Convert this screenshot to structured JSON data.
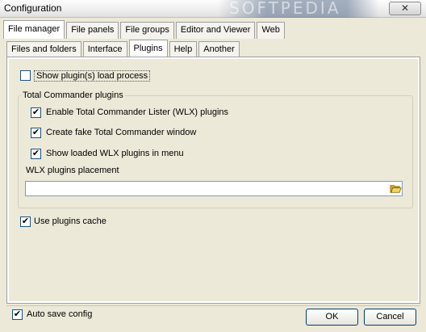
{
  "window": {
    "title": "Configuration",
    "close_label": "✕",
    "watermark": "SOFTPEDIA"
  },
  "tabs_primary": [
    {
      "label": "File manager",
      "active": true
    },
    {
      "label": "File panels",
      "active": false
    },
    {
      "label": "File groups",
      "active": false
    },
    {
      "label": "Editor and Viewer",
      "active": false
    },
    {
      "label": "Web",
      "active": false
    }
  ],
  "tabs_secondary": [
    {
      "label": "Files and folders",
      "active": false
    },
    {
      "label": "Interface",
      "active": false
    },
    {
      "label": "Plugins",
      "active": true
    },
    {
      "label": "Help",
      "active": false
    },
    {
      "label": "Another",
      "active": false
    }
  ],
  "plugins": {
    "show_load_process": {
      "label": "Show plugin(s) load process",
      "checked": false
    },
    "group_title": "Total Commander plugins",
    "enable_wlx": {
      "label": "Enable Total Commander Lister (WLX) plugins",
      "checked": true
    },
    "fake_window": {
      "label": "Create fake Total Commander window",
      "checked": true
    },
    "show_in_menu": {
      "label": "Show loaded WLX plugins in menu",
      "checked": true
    },
    "placement_label": "WLX plugins placement",
    "placement_value": "",
    "use_cache": {
      "label": "Use plugins cache",
      "checked": true
    }
  },
  "footer": {
    "auto_save": {
      "label": "Auto save config",
      "checked": true
    },
    "ok_label": "OK",
    "cancel_label": "Cancel"
  },
  "marks": {
    "checked": "✔",
    "unchecked": ""
  },
  "icons": {
    "folder": "folder-open-icon"
  }
}
